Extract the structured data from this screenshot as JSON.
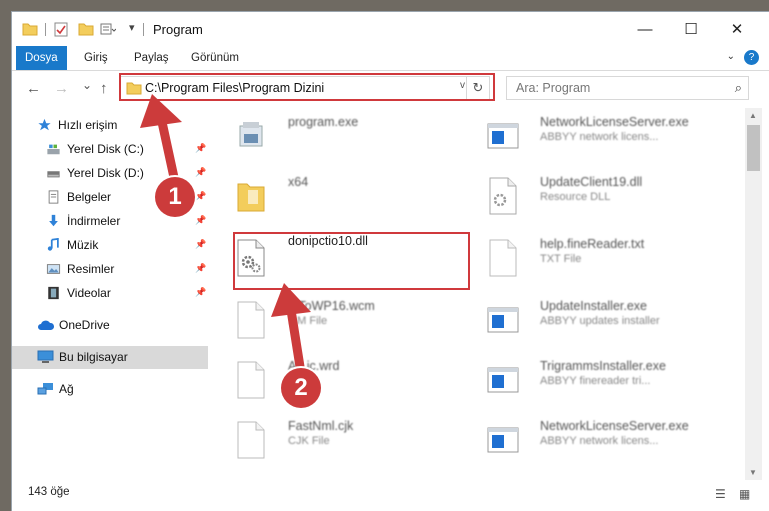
{
  "window": {
    "title": "Program",
    "controls": {
      "minimize": "—",
      "maximize": "☐",
      "close": "✕"
    }
  },
  "ribbon": {
    "tabs": [
      {
        "label": "Dosya",
        "active": true
      },
      {
        "label": "Giriş"
      },
      {
        "label": "Paylaş"
      },
      {
        "label": "Görünüm"
      }
    ],
    "expand_icon": "chevron-down-icon",
    "help": "?"
  },
  "address": {
    "path": "C:\\Program Files\\Program Dizini",
    "dropdown": "v",
    "refresh": "↻"
  },
  "search": {
    "placeholder": "Ara: Program",
    "icon": "⌕"
  },
  "nav": {
    "back": "←",
    "forward": "→",
    "recent": "⌄",
    "up": "↑"
  },
  "sidebar": {
    "items": [
      {
        "label": "Hızlı erişim",
        "icon": "star-icon"
      },
      {
        "label": "Yerel Disk (C:)",
        "icon": "drive-icon",
        "pinned": true
      },
      {
        "label": "Yerel Disk (D:)",
        "icon": "drive-icon",
        "pinned": true
      },
      {
        "label": "Belgeler",
        "icon": "documents-icon",
        "pinned": true
      },
      {
        "label": "İndirmeler",
        "icon": "download-icon",
        "pinned": true
      },
      {
        "label": "Müzik",
        "icon": "music-icon",
        "pinned": true
      },
      {
        "label": "Resimler",
        "icon": "pictures-icon",
        "pinned": true
      },
      {
        "label": "Videolar",
        "icon": "videos-icon",
        "pinned": true
      },
      {
        "label": "OneDrive",
        "icon": "cloud-icon"
      },
      {
        "label": "Bu bilgisayar",
        "icon": "computer-icon",
        "selected": true
      },
      {
        "label": "Ağ",
        "icon": "network-icon"
      }
    ],
    "pin_glyph": "📌"
  },
  "files": {
    "left": [
      {
        "name": "program.exe",
        "type": "",
        "kind": "exe"
      },
      {
        "name": "x64",
        "type": "",
        "kind": "folder"
      },
      {
        "name": "donipctio10.dll",
        "type": "",
        "kind": "dll",
        "highlighted": true
      },
      {
        "name": "...ToWP16.wcm",
        "type": "...M File",
        "kind": "blank"
      },
      {
        "name": "A...ic.wrd",
        "type": "...o",
        "kind": "blank"
      },
      {
        "name": "FastNml.cjk",
        "type": "CJK File",
        "kind": "blank"
      }
    ],
    "right": [
      {
        "name": "NetworkLicenseServer.exe",
        "type": "ABBYY network licens...",
        "kind": "app"
      },
      {
        "name": "UpdateClient19.dll",
        "type": "Resource DLL",
        "kind": "dllgray"
      },
      {
        "name": "help.fineReader.txt",
        "type": "TXT File",
        "kind": "blank"
      },
      {
        "name": "UpdateInstaller.exe",
        "type": "ABBYY updates installer",
        "kind": "app"
      },
      {
        "name": "TrigrammsInstaller.exe",
        "type": "ABBYY finereader tri...",
        "kind": "app"
      },
      {
        "name": "NetworkLicenseServer.exe",
        "type": "ABBYY network licens...",
        "kind": "app"
      }
    ]
  },
  "annotations": {
    "badge1": "1",
    "badge2": "2",
    "color": "#cc3b3b"
  },
  "status": {
    "count": "143 öğe"
  },
  "scroll": {
    "position": 0.05
  }
}
